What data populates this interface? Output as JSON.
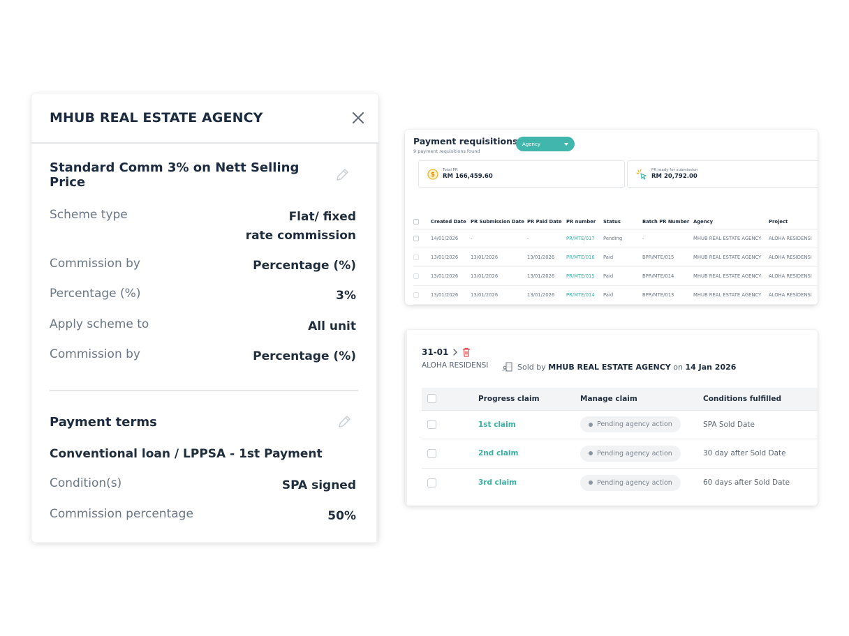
{
  "scheme_panel": {
    "title": "MHUB REAL ESTATE AGENCY",
    "scheme_name": "Standard Comm 3% on Nett Selling Price",
    "details": [
      {
        "label": "Scheme type",
        "value_line1": "Flat/ fixed",
        "value_line2": "rate commission"
      },
      {
        "label": "Commission by",
        "value": "Percentage (%)"
      },
      {
        "label": "Percentage (%)",
        "value": "3%"
      },
      {
        "label": "Apply scheme to",
        "value": "All unit"
      },
      {
        "label": "Commission by",
        "value": "Percentage (%)"
      }
    ],
    "payment_terms": {
      "title": "Payment terms",
      "subtitle": "Conventional loan / LPPSA - 1st Payment",
      "rows": [
        {
          "label": "Condition(s)",
          "value": "SPA signed"
        },
        {
          "label": "Commission percentage",
          "value": "50%"
        }
      ]
    }
  },
  "payment_requisitions": {
    "title": "Payment requisitions",
    "subtitle": "9 payment requisitions found",
    "filter": "Agency",
    "stats": [
      {
        "label": "Total PR",
        "value": "RM 166,459.60",
        "icon": "dollar-coin-icon"
      },
      {
        "label": "PR ready for submission",
        "value": "RM 20,792.00",
        "icon": "sparkle-click-icon"
      }
    ],
    "columns": [
      "Created Date",
      "PR Submission Date",
      "PR Paid Date",
      "PR number",
      "Status",
      "Batch PR Number",
      "Agency",
      "Project"
    ],
    "rows": [
      {
        "created": "14/01/2026",
        "submitted": "-",
        "paid": "-",
        "pr_number": "PR/MTE/017",
        "status": "Pending",
        "batch": "-",
        "agency": "MHUB REAL ESTATE AGENCY",
        "project": "ALOHA RESIDENSI"
      },
      {
        "created": "13/01/2026",
        "submitted": "13/01/2026",
        "paid": "13/01/2026",
        "pr_number": "PR/MTE/016",
        "status": "Paid",
        "batch": "BPR/MTE/015",
        "agency": "MHUB REAL ESTATE AGENCY",
        "project": "ALOHA RESIDENSI"
      },
      {
        "created": "13/01/2026",
        "submitted": "13/01/2026",
        "paid": "13/01/2026",
        "pr_number": "PR/MTE/015",
        "status": "Paid",
        "batch": "BPR/MTE/014",
        "agency": "MHUB REAL ESTATE AGENCY",
        "project": "ALOHA RESIDENSI"
      },
      {
        "created": "13/01/2026",
        "submitted": "13/01/2026",
        "paid": "13/01/2026",
        "pr_number": "PR/MTE/014",
        "status": "Paid",
        "batch": "BPR/MTE/013",
        "agency": "MHUB REAL ESTATE AGENCY",
        "project": "ALOHA RESIDENSI"
      }
    ]
  },
  "unit_card": {
    "unit_number": "31-01",
    "project": "ALOHA RESIDENSI",
    "sold_by_prefix": "Sold by",
    "agency": "MHUB REAL ESTATE AGENCY",
    "on_text": "on",
    "sold_date": "14 Jan 2026",
    "columns": [
      "Progress claim",
      "Manage claim",
      "Conditions fulfilled"
    ],
    "claims": [
      {
        "name": "1st claim",
        "status": "Pending agency action",
        "condition": "SPA Sold Date"
      },
      {
        "name": "2nd claim",
        "status": "Pending agency action",
        "condition": "30 day after Sold Date"
      },
      {
        "name": "3rd claim",
        "status": "Pending agency action",
        "condition": "60 days after Sold Date"
      }
    ]
  },
  "colors": {
    "accent": "#41b6ac",
    "link": "#3aaea3",
    "heading": "#1c2b3f",
    "muted": "#6b7785",
    "delete": "#e5484d"
  }
}
